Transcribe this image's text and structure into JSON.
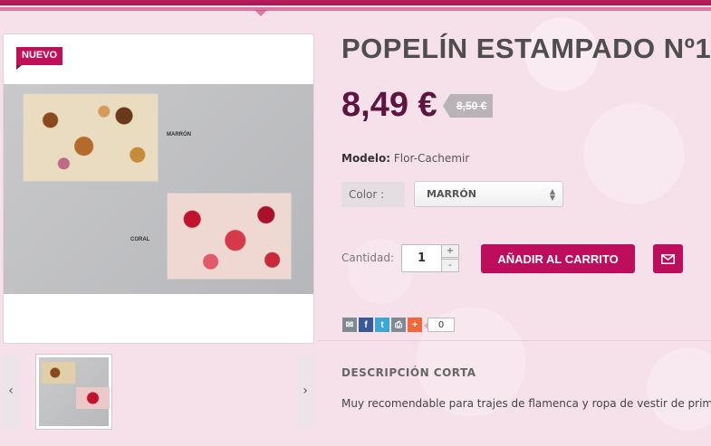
{
  "badge": {
    "new": "NUEVO"
  },
  "image": {
    "label_top": "MARRÓN",
    "label_bottom": "CORAL"
  },
  "nav": {
    "prev": "‹",
    "next": "›"
  },
  "product": {
    "title": "POPELÍN ESTAMPADO Nº1",
    "price": "8,49 €",
    "old_price": "8,50 €",
    "model_label": "Modelo:",
    "model_value": "Flor-Cachemir"
  },
  "options": {
    "color_label": "Color :",
    "color_value": "MARRÓN"
  },
  "quantity": {
    "label": "Cantidad:",
    "value": "1",
    "plus": "+",
    "minus": "-"
  },
  "actions": {
    "add_to_cart": "AÑADIR AL CARRITO"
  },
  "share": {
    "count": "0",
    "icons": [
      "email-icon",
      "facebook-icon",
      "twitter-icon",
      "print-icon",
      "addthis-icon"
    ]
  },
  "description": {
    "title": "DESCRIPCIÓN CORTA",
    "text": "Muy recomendable para trajes de flamenca y ropa de vestir de primavera"
  },
  "colors": {
    "brand": "#bf0d5e",
    "price": "#5e1440",
    "background": "#f6e1ea"
  }
}
